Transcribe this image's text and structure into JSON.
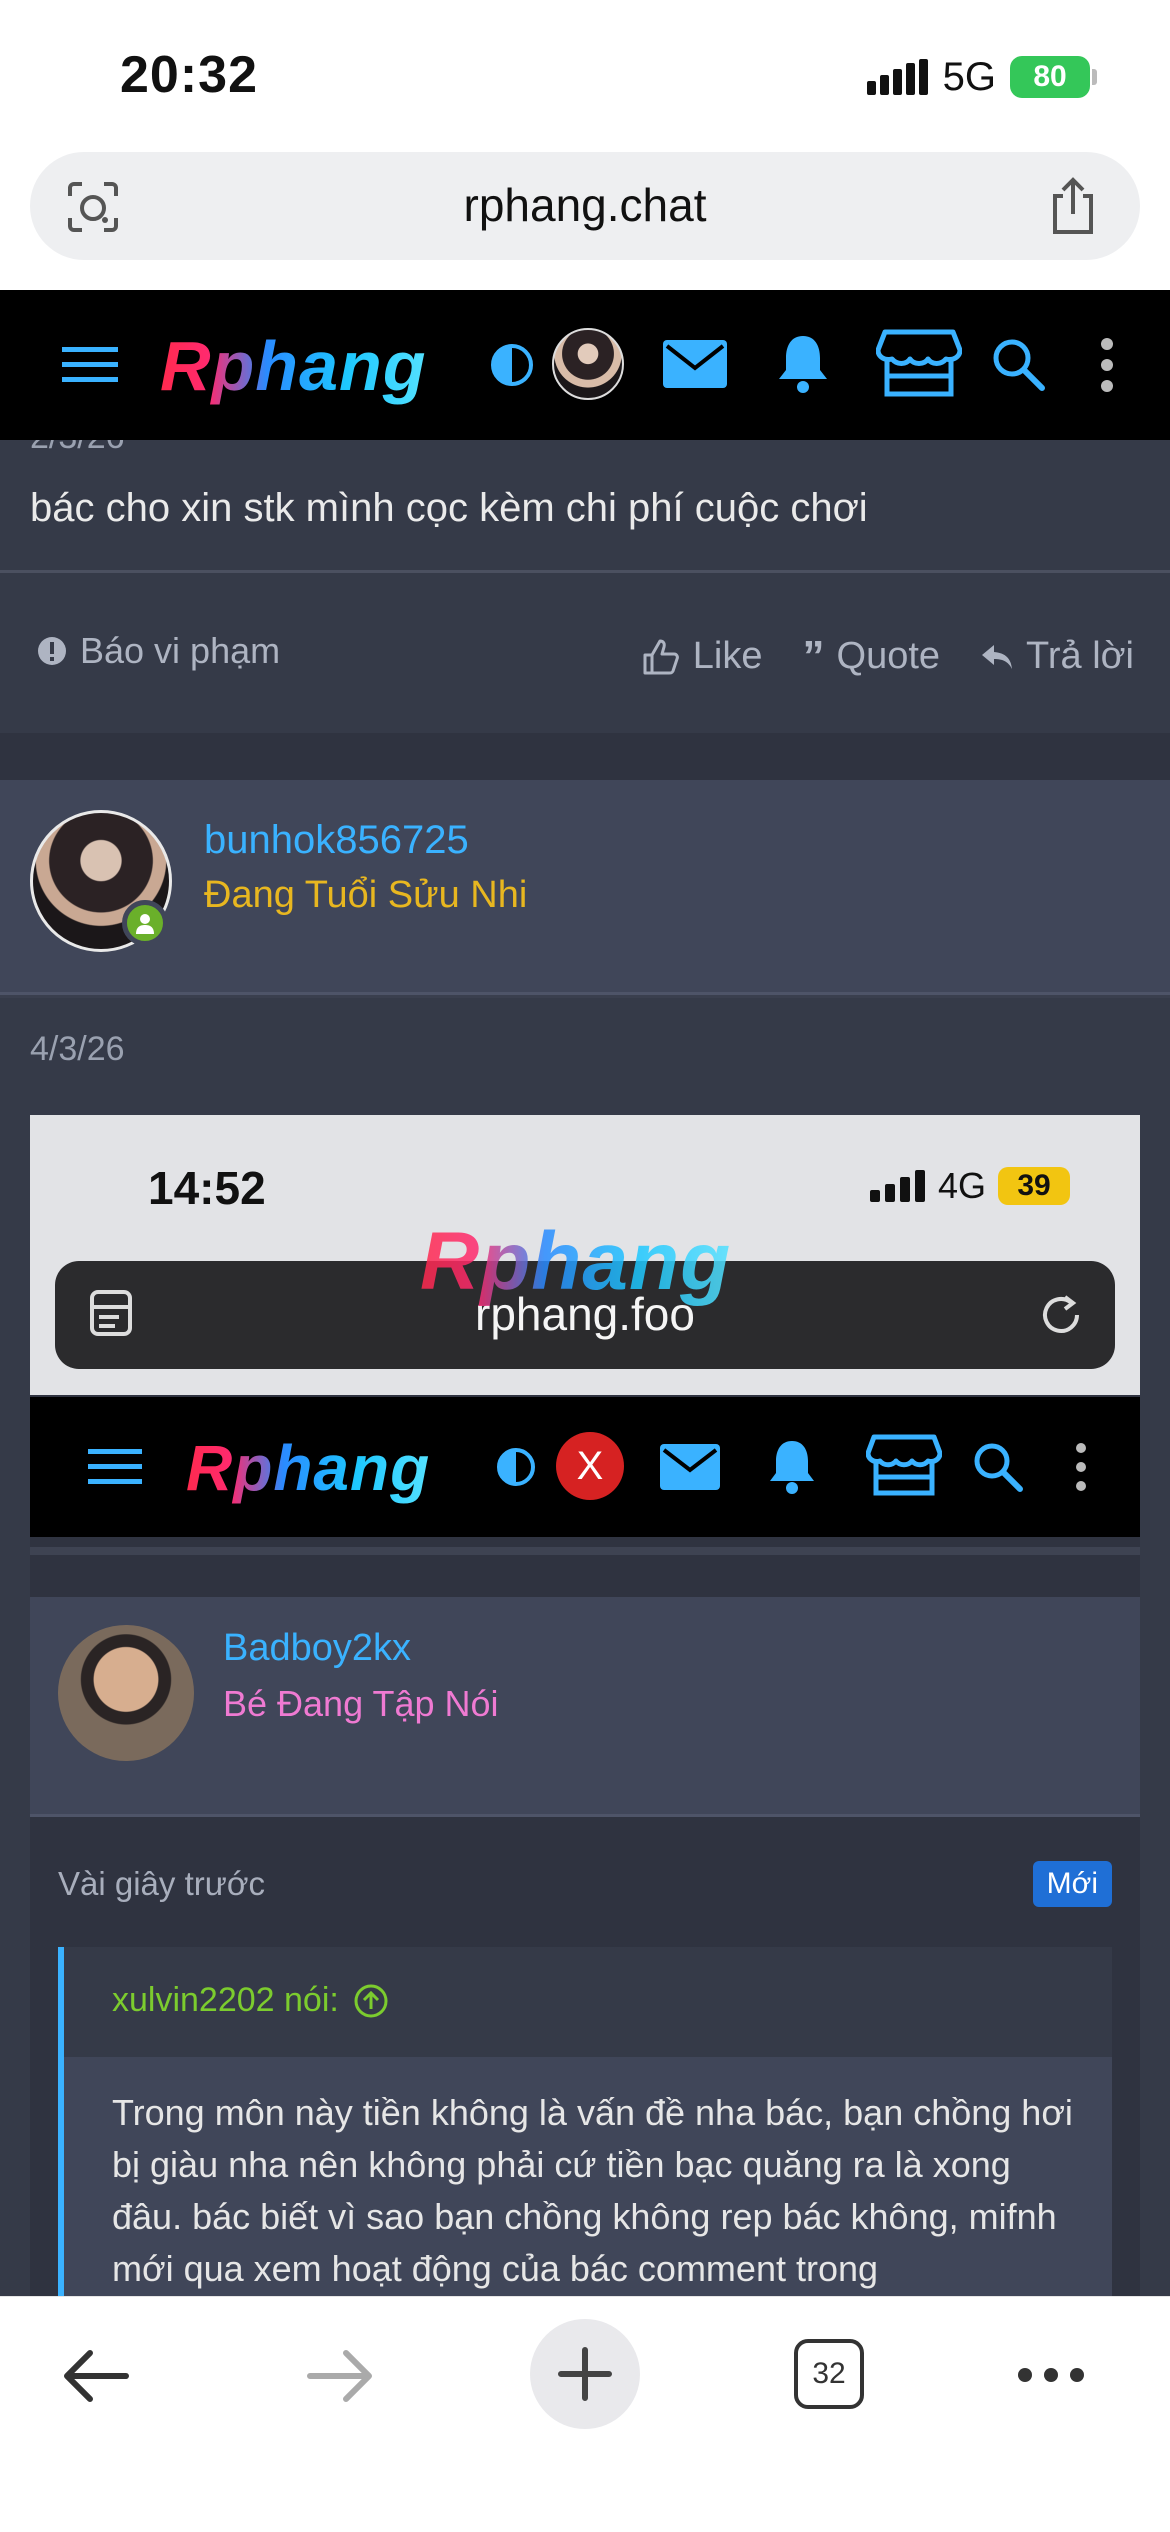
{
  "status_bar": {
    "time": "20:32",
    "network": "5G",
    "battery": "80"
  },
  "browser": {
    "url": "rphang.chat",
    "tab_count": "32"
  },
  "site": {
    "logo": "Rphang"
  },
  "post_prev": {
    "date_partial": "2/3/26",
    "text": "bác cho xin stk mình cọc kèm chi phí cuộc chơi",
    "report_label": "Báo vi phạm",
    "like_label": "Like",
    "quote_label": "Quote",
    "reply_label": "Trả lời"
  },
  "post": {
    "username": "bunhok856725",
    "user_title": "Đang Tuổi Sửu Nhi",
    "date": "4/3/26"
  },
  "embedded": {
    "time": "14:52",
    "network": "4G",
    "battery": "39",
    "watermark": "Rphang",
    "url": "rphang.foo",
    "logo": "Rphang",
    "avatar_letter": "X",
    "username": "Badboy2kx",
    "user_title": "Bé Đang Tập Nói",
    "time_ago": "Vài giây trước",
    "badge": "Mới",
    "quote_author": "xulvin2202 nói:",
    "quote_text": "Trong môn này tiền không là vấn đề nha bác, bạn chồng hơi bị giàu nha nên không phải cứ tiền bạc quăng ra là xong đâu. bác biết vì sao bạn chồng không rep bác không, mifnh mới qua xem hoạt động của bác comment trong"
  },
  "colors": {
    "accent": "#3ab2ff",
    "user_title_gold": "#e8b720",
    "user_title_pink": "#ef7ad2",
    "quote_author_green": "#7ccc2e",
    "online_green": "#6ab02a",
    "badge_blue": "#1f6fd6"
  }
}
